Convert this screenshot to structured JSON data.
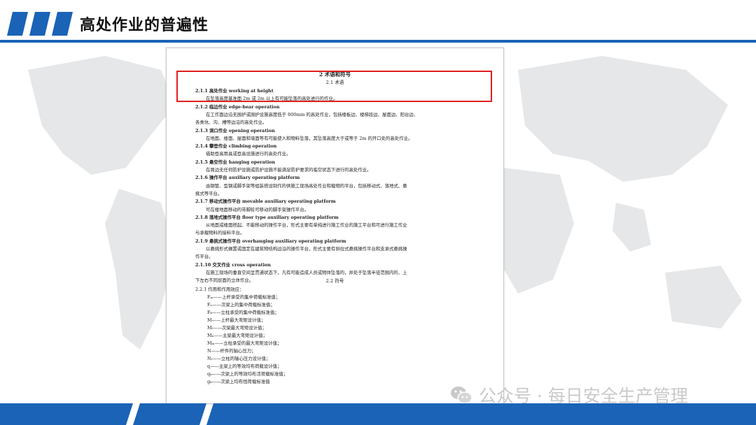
{
  "header": {
    "title": "高处作业的普遍性"
  },
  "colors": {
    "brand": "#1a63b7",
    "highlight": "#e02020",
    "map": "#e6e7e9"
  },
  "document": {
    "chapter_title": "2  术语和符号",
    "section_terms": "2.1  术语",
    "section_symbols": "2.2  符号",
    "lines": [
      "2.1.1  高处作业  working at height",
      "在坠落高度基准面 2m 或 2m 以上有可能坠落的高处进行的作业。",
      "2.1.2  临边作业  edge-bear operation",
      "在工作面边沿无围护或围护设施高度低于 800mm 的高处作业，包括楼板边、楼梯段边、屋面边、阳台边、",
      "各类坑、沟、槽等边沿的高处作业。",
      "2.1.3  洞口作业  opening operation",
      "在地面、楼面、屋面和墙面等有可能使人和物料坠落，其坠落高度大于或等于 2m 的开口处的高处作业。",
      "2.1.4  攀登作业  climbing operation",
      "借助登高用具或登高设施进行的高处作业。",
      "2.1.5  悬空作业  hanging operation",
      "在周边无任何防护设施或防护设施不能满足防护要求的临空状态下进行的高处作业。",
      "2.1.6  操作平台  auxiliary operating platform",
      "由钢管、型钢或脚手架等组装搭设制作的供施工现场高处作业和载物的平台，包括移动式、落地式、悬",
      "挑式等平台。",
      "2.1.7  移动式操作平台  movable auxiliary operating platform",
      "可在楼地面移动的带脚轮可移动的脚手架操作平台。",
      "2.1.8  落地式操作平台  floor type auxiliary operating platform",
      "从地面或楼面搭起、不能移动的操作平台，形式主要有单纯进行施工作业的施工平台和可进行施工作业",
      "与承载物料的接料平台。",
      "2.1.9  悬挑式操作平台  overhanging auxiliary operating platform",
      "以悬挑形式搁置或固定在建筑物结构边沿的操作平台，形式主要有斜拉式悬挑操作平台和支承式悬挑操",
      "作平台。",
      "2.1.10  交叉作业  cross operation",
      "在施工现场的垂直空间呈贯通状态下，凡有可能造成人员或物体坠落的，并处于坠落半径范围内的、上",
      "下左右不同层面的立体作业。"
    ],
    "symbol_lines": [
      "2.2.1  作用和作用效应：",
      "Fₘ——上杆承受的集中荷载标准值；",
      "Fₙ——次梁上的集中荷载标准值；",
      "Fₖ——立柱承受的集中荷载标准值；",
      "M——上杆最大弯矩设计值；",
      "Mₗ——次梁最大弯矩设计值；",
      "Mₓ——主梁最大弯矩设计值；",
      "Mₘ——立柱承受的最大弯矩设计值；",
      "N——杆件的轴心压力；",
      "Nₗ——立柱的轴心压力设计值；",
      "q——主梁上的等效均布荷载设计值；",
      "qₖ——次梁上的等效均布活荷载标准值；",
      "gₖ——次梁上均布恒荷载标准值"
    ]
  },
  "watermark": {
    "text": "公众号 · 每日安全生产管理",
    "icon": "wechat-icon"
  }
}
